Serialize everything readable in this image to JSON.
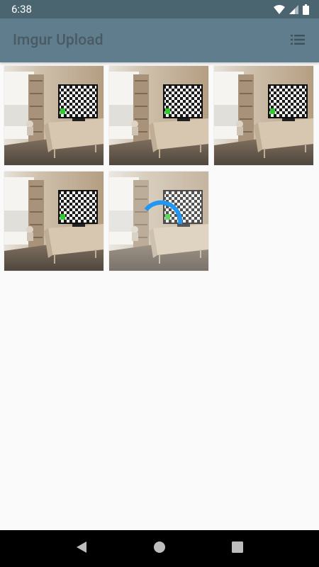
{
  "status_bar": {
    "time": "6:38"
  },
  "app_bar": {
    "title": "Imgur Upload",
    "action_icon": "list-icon"
  },
  "grid": {
    "items": [
      {
        "label": "",
        "state": "loaded"
      },
      {
        "label": "",
        "state": "loaded"
      },
      {
        "label": "",
        "state": "loaded"
      },
      {
        "label": "",
        "state": "loaded"
      },
      {
        "label": "",
        "state": "uploading"
      }
    ]
  },
  "nav_bar": {
    "back_icon": "back-icon",
    "home_icon": "home-icon",
    "recents_icon": "recents-icon"
  },
  "colors": {
    "status_bar": "#4a6470",
    "app_bar": "#5f7d8c",
    "title": "#4a5a63",
    "spinner": "#2196f3",
    "background": "#fafafa"
  }
}
